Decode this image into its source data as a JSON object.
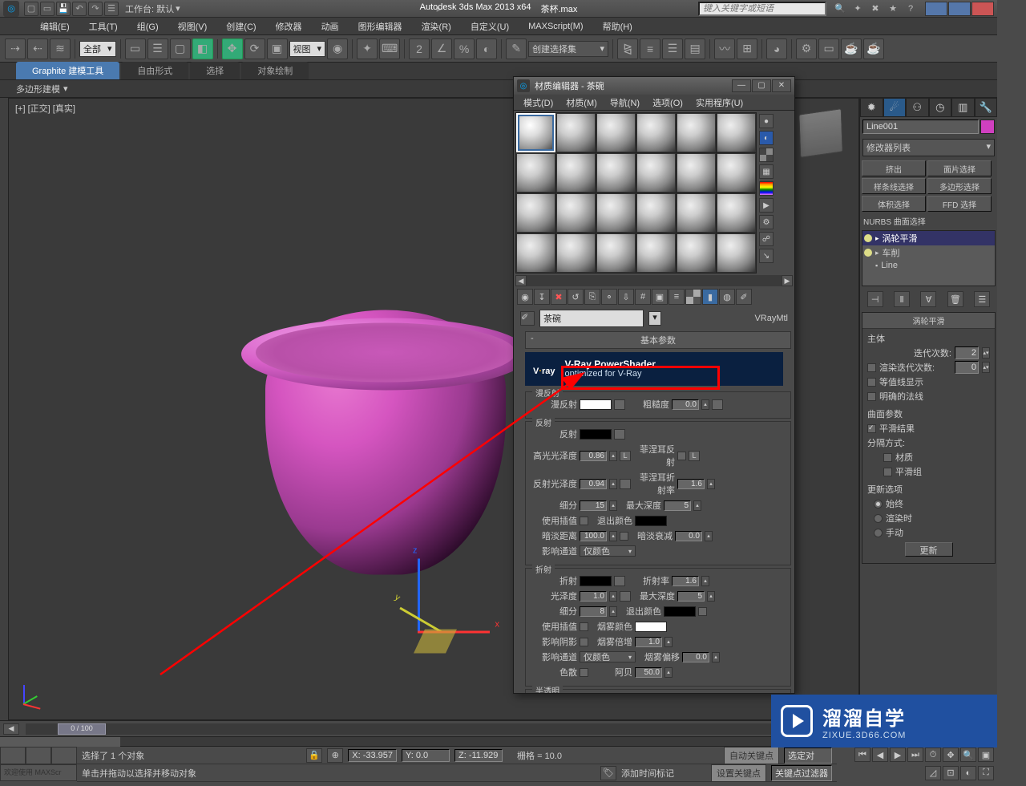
{
  "titlebar": {
    "workspace_label": "工作台: 默认",
    "app_title": "Autodesk 3ds Max  2013 x64",
    "doc_title": "茶杯.max",
    "search_placeholder": "键入关键字或短语"
  },
  "menus": [
    "编辑(E)",
    "工具(T)",
    "组(G)",
    "视图(V)",
    "创建(C)",
    "修改器",
    "动画",
    "图形编辑器",
    "渲染(R)",
    "自定义(U)",
    "MAXScript(M)",
    "帮助(H)"
  ],
  "maintb": {
    "sel_filter": "全部",
    "ref_coord": "视图",
    "named_sel": "创建选择集"
  },
  "ribbon": {
    "tabs": [
      "Graphite 建模工具",
      "自由形式",
      "选择",
      "对象绘制"
    ],
    "sub": "多边形建模"
  },
  "viewport": {
    "label": "[+] [正交] [真实]"
  },
  "cmdpanel": {
    "obj_name": "Line001",
    "mod_list_label": "修改器列表",
    "mod_btns": [
      "挤出",
      "面片选择",
      "样条线选择",
      "多边形选择",
      "体积选择",
      "FFD 选择"
    ],
    "nurbs": "NURBS 曲面选择",
    "stack": [
      "涡轮平滑",
      "车削",
      "Line"
    ],
    "roll0": {
      "title": "涡轮平滑",
      "main_label": "主体",
      "iter_label": "迭代次数:",
      "iter": "2",
      "rend_iter_label": "渲染迭代次数:",
      "rend_iter": "0",
      "iso_label": "等值线显示",
      "normals_label": "明确的法线",
      "surf_label": "曲面参数",
      "smooth_label": "平滑结果",
      "sep_label": "分隔方式:",
      "mat_label": "材质",
      "sg_label": "平滑组",
      "upd_title": "更新选项",
      "upd_opts": [
        "始终",
        "渲染时",
        "手动"
      ],
      "upd_btn": "更新"
    }
  },
  "mateditor": {
    "title": "材质编辑器 - 茶碗",
    "menus": [
      "模式(D)",
      "材质(M)",
      "导航(N)",
      "选项(O)",
      "实用程序(U)"
    ],
    "mat_name": "茶碗",
    "mat_type": "VRayMtl",
    "basic_hdr": "基本参数",
    "vray": {
      "brand": "V·ray",
      "headline": "V-Ray PowerShader",
      "sub": "optimized for V-Ray"
    },
    "diffuse": {
      "title": "漫反射",
      "diff": "漫反射",
      "rough": "粗糙度",
      "rough_v": "0.0"
    },
    "reflect": {
      "title": "反射",
      "refl": "反射",
      "hgloss": "高光光泽度",
      "hgloss_v": "0.86",
      "l": "L",
      "fres": "菲涅耳反射",
      "flock": "L",
      "rgloss": "反射光泽度",
      "rgloss_v": "0.94",
      "fior": "菲涅耳折射率",
      "fior_v": "1.6",
      "subdiv": "细分",
      "subdiv_v": "15",
      "maxd": "最大深度",
      "maxd_v": "5",
      "interp": "使用插值",
      "exitc": "退出颜色",
      "dim": "暗淡距离",
      "dim_v": "100.0",
      "dimf": "暗淡衰减",
      "dimf_v": "0.0",
      "affect": "影响通道",
      "affect_v": "仅颜色"
    },
    "refract": {
      "title": "折射",
      "refr": "折射",
      "ior": "折射率",
      "ior_v": "1.6",
      "gloss": "光泽度",
      "gloss_v": "1.0",
      "maxd": "最大深度",
      "maxd_v": "5",
      "subdiv": "细分",
      "subdiv_v": "8",
      "exitc": "退出颜色",
      "interp": "使用插值",
      "fogc": "烟雾颜色",
      "shadow": "影响阴影",
      "fogm": "烟雾倍增",
      "fogm_v": "1.0",
      "affect": "影响通道",
      "affect_v": "仅颜色",
      "fogb": "烟雾偏移",
      "fogb_v": "0.0",
      "disp": "色散",
      "abbe": "阿贝",
      "abbe_v": "50.0"
    },
    "trans_hdr": "半透明"
  },
  "timeline": {
    "frame": "0 / 100"
  },
  "status": {
    "welcome": "欢迎使用 MAXScr",
    "sel": "选择了 1 个对象",
    "hint": "单击并拖动以选择并移动对象",
    "x": "X: -33.957",
    "y": "Y: 0.0",
    "z": "Z: -11.929",
    "grid": "栅格 = 10.0",
    "addtime": "添加时间标记",
    "autokey": "自动关键点",
    "setkey": "设置关键点",
    "selkey": "选定对",
    "keyfilter": "关键点过滤器"
  },
  "watermark": {
    "t1": "溜溜自学",
    "t2": "ZIXUE.3D66.COM"
  }
}
